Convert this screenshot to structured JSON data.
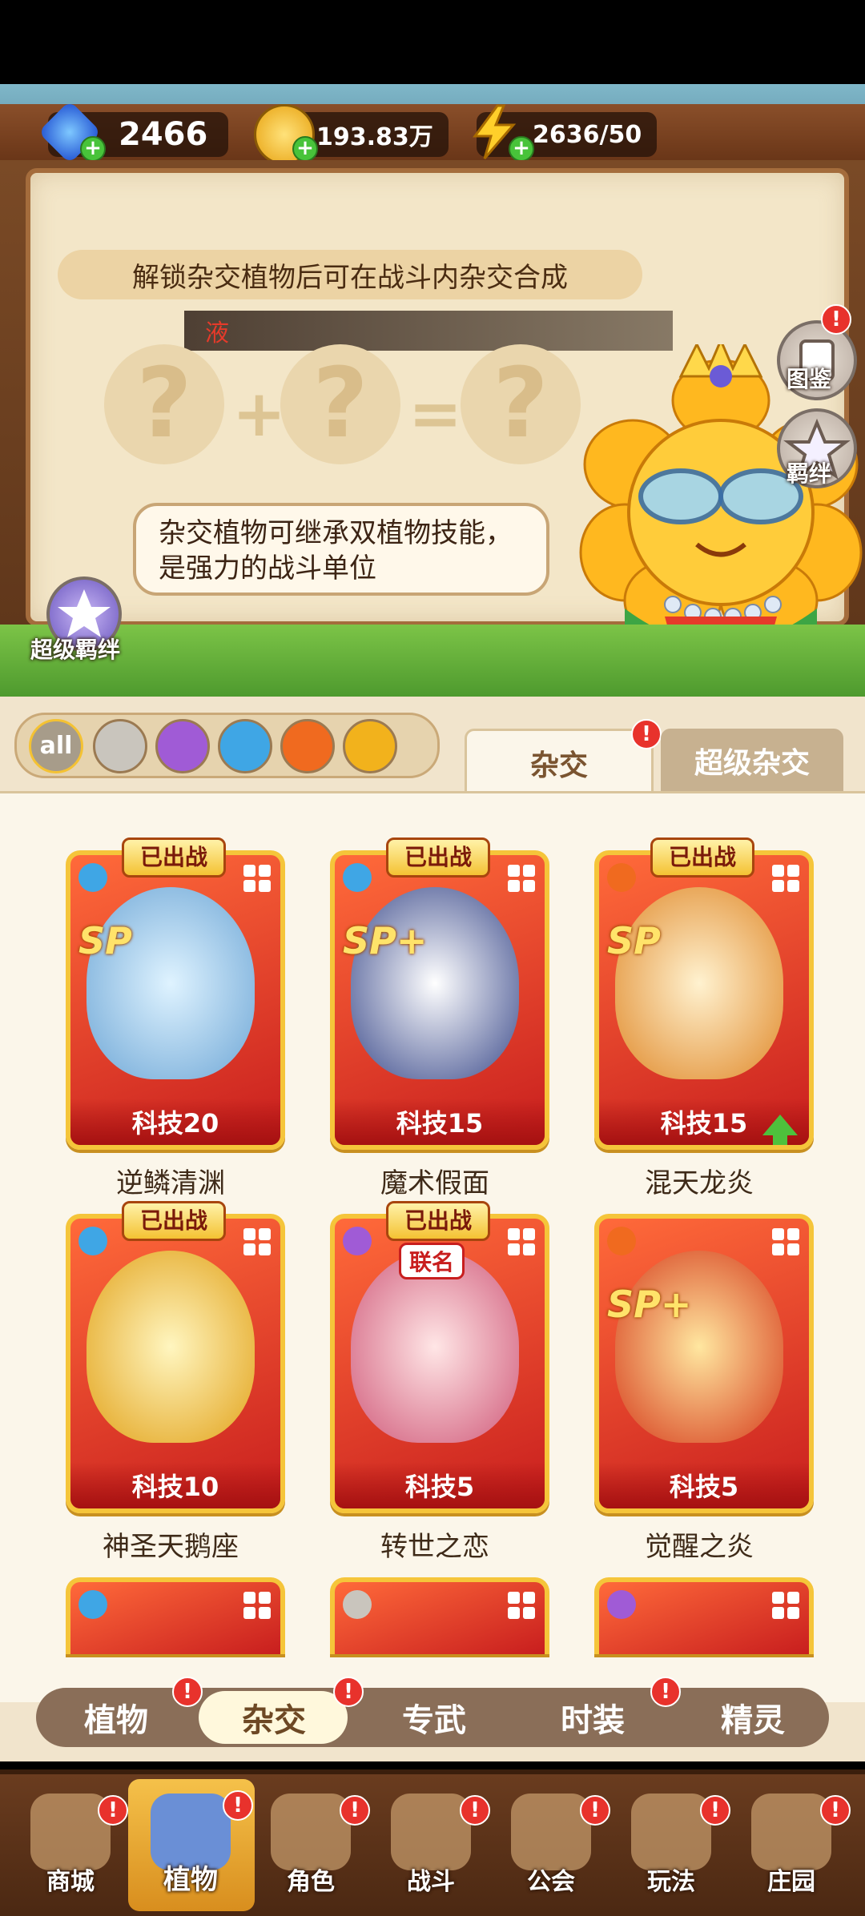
{
  "resources": {
    "gems": {
      "value": "2466",
      "icon": "gem-icon"
    },
    "coins": {
      "value": "193.83万",
      "icon": "coin-icon"
    },
    "energy": {
      "value": "2636/50",
      "icon": "lightning-icon"
    }
  },
  "scene": {
    "hint": "解锁杂交植物后可在战斗内杂交合成",
    "dark_bar_text": "液",
    "bubble": "杂交植物可继承双植物技能，是强力的战斗单位",
    "side_buttons": [
      {
        "label": "图鉴",
        "badge": "!"
      },
      {
        "label": "羁绊"
      }
    ],
    "super_bond": "超级羁绊",
    "formula": {
      "plus": "+",
      "equals": "="
    }
  },
  "filters": {
    "all_label": "all",
    "chips": [
      "all",
      "sword-icon",
      "potion-icon",
      "water-drop-icon",
      "fire-icon",
      "lightning-icon"
    ]
  },
  "top_tabs": [
    {
      "label": "杂交",
      "active": true,
      "badge": "!"
    },
    {
      "label": "超级杂交",
      "active": false
    }
  ],
  "cards": [
    {
      "name": "逆鳞清渊",
      "tech": "科技20",
      "deployed": "已出战",
      "tag": "SP",
      "element": "water"
    },
    {
      "name": "魔术假面",
      "tech": "科技15",
      "deployed": "已出战",
      "tag": "SP+",
      "element": "water"
    },
    {
      "name": "混天龙炎",
      "tech": "科技15",
      "deployed": "已出战",
      "tag": "SP",
      "element": "fire",
      "upgrade": true
    },
    {
      "name": "神圣天鹅座",
      "tech": "科技10",
      "deployed": "已出战",
      "tag": "",
      "element": "water"
    },
    {
      "name": "转世之恋",
      "tech": "科技5",
      "deployed": "已出战",
      "tag": "联名",
      "element": "potion"
    },
    {
      "name": "觉醒之炎",
      "tech": "科技5",
      "deployed": "",
      "tag": "SP+",
      "element": "fire"
    }
  ],
  "sub_tabs": [
    {
      "label": "植物",
      "badge": "!"
    },
    {
      "label": "杂交",
      "badge": "!",
      "active": true
    },
    {
      "label": "专武"
    },
    {
      "label": "时装",
      "badge": "!"
    },
    {
      "label": "精灵"
    }
  ],
  "bottom_nav": [
    {
      "label": "商城",
      "badge": "!"
    },
    {
      "label": "植物",
      "badge": "!",
      "active": true
    },
    {
      "label": "角色",
      "badge": "!"
    },
    {
      "label": "战斗",
      "badge": "!"
    },
    {
      "label": "公会",
      "badge": "!"
    },
    {
      "label": "玩法",
      "badge": "!"
    },
    {
      "label": "庄园",
      "badge": "!"
    }
  ],
  "colors": {
    "accent": "#f4c233",
    "card_red": "#c81e1e",
    "badge_red": "#e8322c"
  }
}
